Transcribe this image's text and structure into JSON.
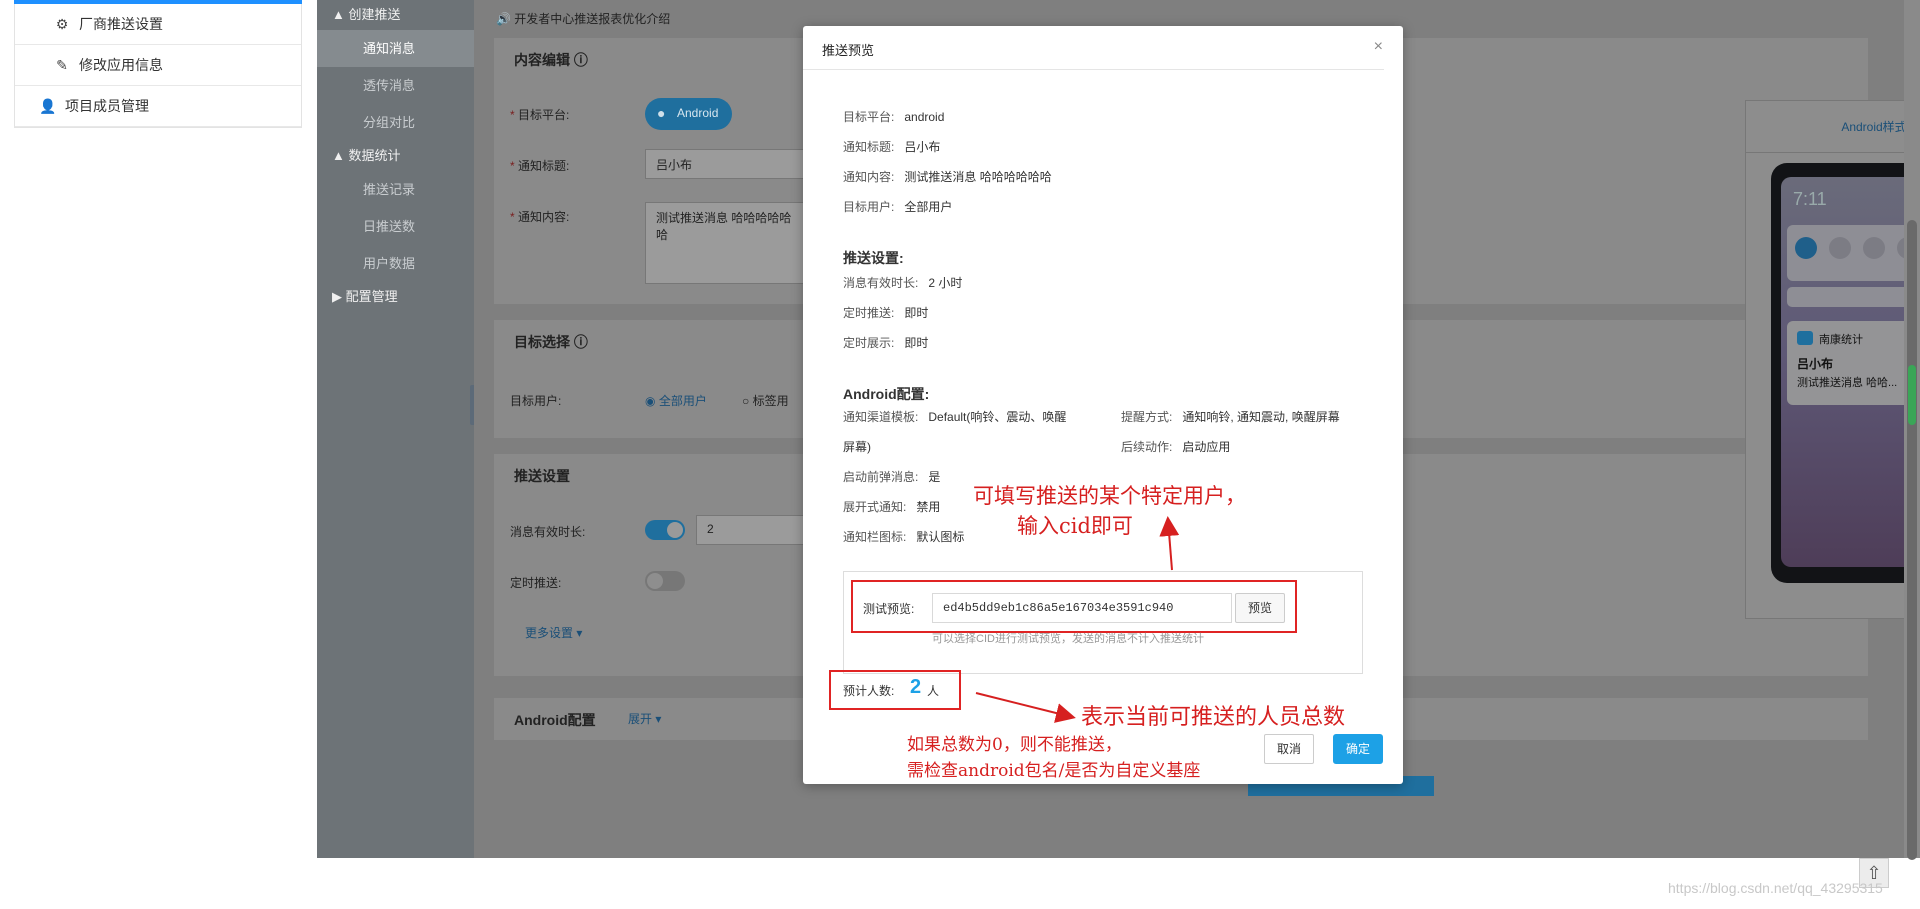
{
  "left_menu": {
    "items": [
      {
        "icon": "gear-icon",
        "label": "厂商推送设置"
      },
      {
        "icon": "edit-icon",
        "label": "修改应用信息"
      },
      {
        "icon": "user-icon",
        "label": "项目成员管理"
      }
    ]
  },
  "nav": {
    "group_create": "▲ 创建推送",
    "items_create": [
      "通知消息",
      "透传消息",
      "分组对比"
    ],
    "group_stats": "▲ 数据统计",
    "items_stats": [
      "推送记录",
      "日推送数",
      "用户数据"
    ],
    "group_config": "▶ 配置管理"
  },
  "content": {
    "notice": "🔊 开发者中心推送报表优化介绍",
    "content_edit": {
      "title": "内容编辑 ⓘ",
      "platform_label": "目标平台:",
      "platform_value": "Android",
      "title_label": "通知标题:",
      "title_value": "吕小布",
      "body_label": "通知内容:",
      "body_value": "测试推送消息 哈哈哈哈哈哈"
    },
    "target": {
      "title": "目标选择 ⓘ",
      "user_label": "目标用户:",
      "all_users": "全部用户",
      "tag_users": "标签用"
    },
    "push_settings": {
      "title": "推送设置",
      "ttl_label": "消息有效时长:",
      "ttl_value": "2",
      "timed_label": "定时推送:",
      "more": "更多设置 ▾"
    },
    "android_config": {
      "title": "Android配置",
      "expand": "展开 ▾"
    },
    "preview_panel": {
      "title": "Android样式",
      "time": "7:11",
      "notif_app": "南康统计",
      "notif_title": "吕小布",
      "notif_body": "测试推送消息 哈哈..."
    }
  },
  "modal": {
    "title": "推送预览",
    "close": "×",
    "basic": [
      {
        "k": "目标平台:",
        "v": "android"
      },
      {
        "k": "通知标题:",
        "v": "吕小布"
      },
      {
        "k": "通知内容:",
        "v": "测试推送消息 哈哈哈哈哈哈"
      },
      {
        "k": "目标用户:",
        "v": "全部用户"
      }
    ],
    "push_section": "推送设置:",
    "push": [
      {
        "k": "消息有效时长:",
        "v": "2 小时"
      },
      {
        "k": "定时推送:",
        "v": "即时"
      },
      {
        "k": "定时展示:",
        "v": "即时"
      }
    ],
    "android_section": "Android配置:",
    "android_left": [
      {
        "k": "通知渠道模板:",
        "v": "Default(响铃、震动、唤醒"
      },
      {
        "k": "",
        "v": "屏幕)"
      },
      {
        "k": "启动前弹消息:",
        "v": "是"
      },
      {
        "k": "展开式通知:",
        "v": "禁用"
      },
      {
        "k": "通知栏图标:",
        "v": "默认图标"
      }
    ],
    "android_right": [
      {
        "k": "提醒方式:",
        "v": "通知响铃, 通知震动, 唤醒屏幕"
      },
      {
        "k": "后续动作:",
        "v": "启动应用"
      }
    ],
    "test_label": "测试预览:",
    "test_value": "ed4b5dd9eb1c86a5e167034e3591c940",
    "preview_btn": "预览",
    "hint": "可以选择CID进行测试预览，发送的消息不计入推送统计",
    "count_label": "预计人数:",
    "count_value": "2",
    "count_unit": "人",
    "cancel": "取消",
    "ok": "确定"
  },
  "annotations": {
    "cid_line1": "可填写推送的某个特定用户，",
    "cid_line2": "输入cid即可",
    "count_desc": "表示当前可推送的人员总数",
    "zero_line1": "如果总数为0，则不能推送，",
    "zero_line2": "需检查android包名/是否为自定义基座"
  },
  "watermark": "https://blog.csdn.net/qq_43295315"
}
